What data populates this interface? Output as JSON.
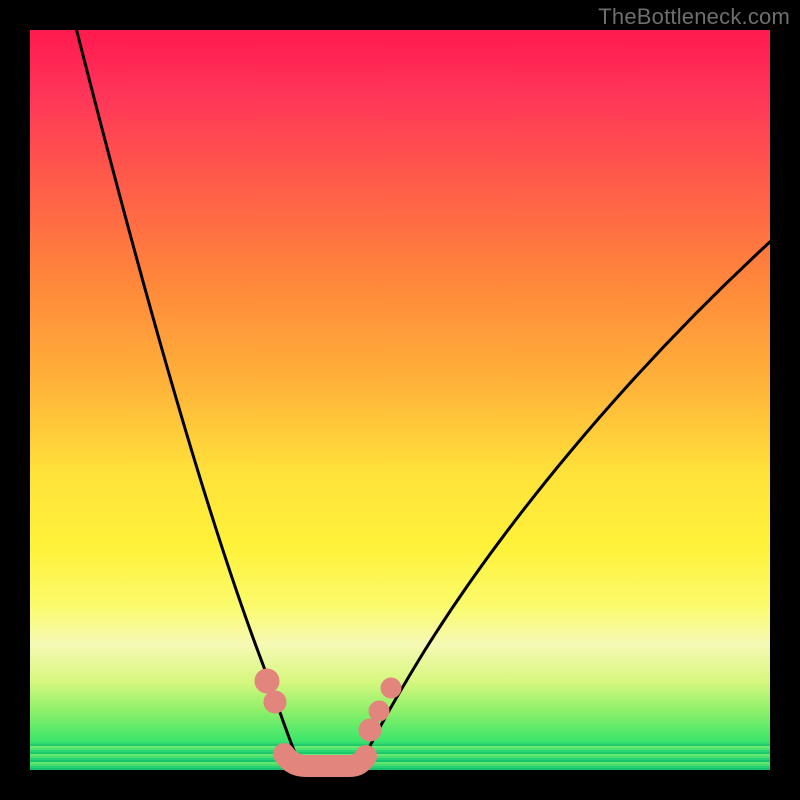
{
  "watermark": "TheBottleneck.com",
  "colors": {
    "accent_pink": "#e2857d",
    "curve": "#000000"
  },
  "chart_data": {
    "type": "line",
    "title": "",
    "xlabel": "",
    "ylabel": "",
    "xlim": [
      0,
      100
    ],
    "ylim": [
      0,
      100
    ],
    "grid": false,
    "legend": false,
    "series": [
      {
        "name": "left-branch",
        "x": [
          6,
          10,
          15,
          20,
          25,
          28,
          30,
          32,
          34,
          36
        ],
        "y": [
          100,
          80,
          55,
          34,
          18,
          11,
          7,
          4,
          1.5,
          0
        ]
      },
      {
        "name": "valley-floor",
        "x": [
          36,
          40,
          44
        ],
        "y": [
          0,
          0,
          0
        ]
      },
      {
        "name": "right-branch",
        "x": [
          44,
          48,
          55,
          62,
          72,
          82,
          92,
          100
        ],
        "y": [
          0,
          3,
          10,
          20,
          37,
          52,
          64,
          72
        ]
      }
    ],
    "annotations": [
      {
        "name": "pink-marker-left-upper",
        "x": 31.5,
        "y": 12,
        "r": 1.6
      },
      {
        "name": "pink-marker-left-lower",
        "x": 32.5,
        "y": 9.5,
        "r": 1.4
      },
      {
        "name": "pink-marker-right-1",
        "x": 44.5,
        "y": 6.0,
        "r": 1.4
      },
      {
        "name": "pink-marker-right-2",
        "x": 46.0,
        "y": 8.5,
        "r": 1.3
      },
      {
        "name": "pink-marker-right-3",
        "x": 47.8,
        "y": 11.5,
        "r": 1.3
      },
      {
        "name": "pink-valley-bar",
        "x": 39.5,
        "y": 0.5,
        "w": 9,
        "h": 2.3
      }
    ]
  }
}
